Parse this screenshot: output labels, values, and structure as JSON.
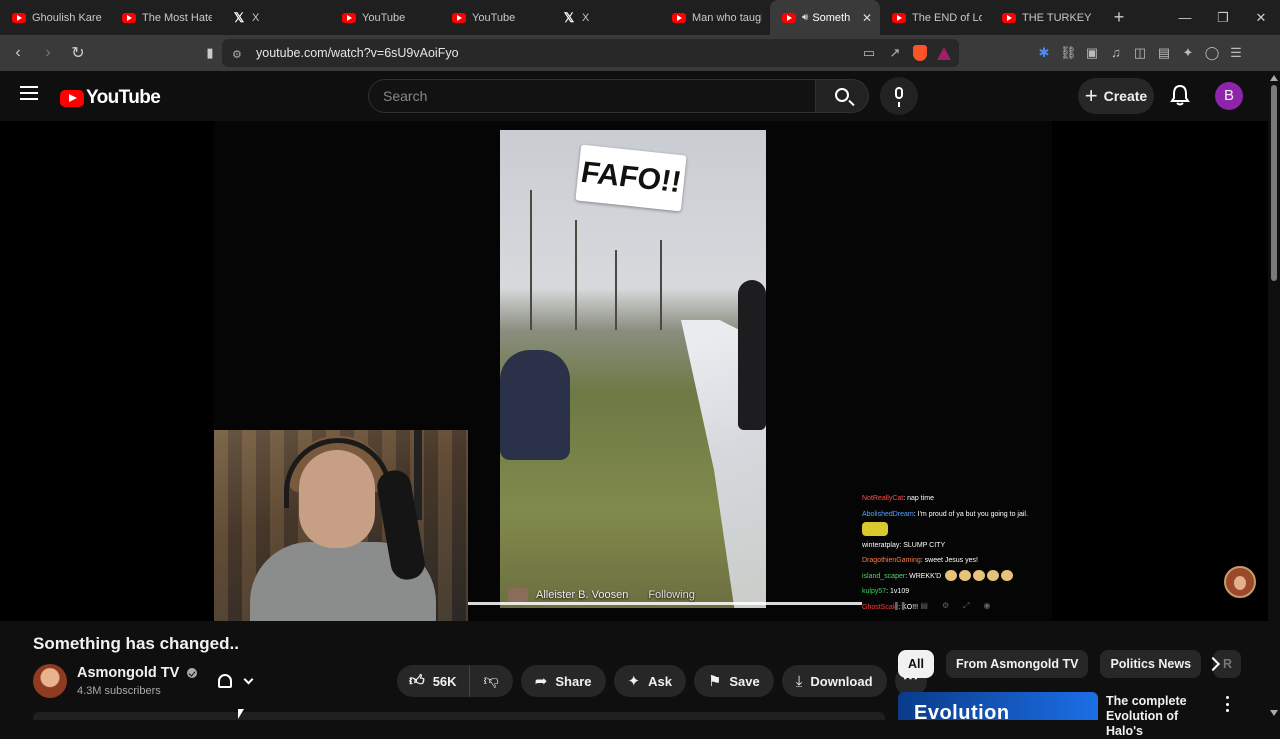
{
  "browser": {
    "tabs": [
      {
        "title": "Ghoulish Karen",
        "icon": "youtube-icon",
        "active": false
      },
      {
        "title": "The Most Hated",
        "icon": "youtube-icon",
        "active": false
      },
      {
        "title": "X",
        "icon": "x-icon",
        "active": false
      },
      {
        "title": "YouTube",
        "icon": "youtube-icon",
        "active": false
      },
      {
        "title": "YouTube",
        "icon": "youtube-icon",
        "active": false
      },
      {
        "title": "X",
        "icon": "x-icon",
        "active": false
      },
      {
        "title": "Man who taugh",
        "icon": "youtube-icon",
        "active": false
      },
      {
        "title": "Someth",
        "icon": "youtube-icon",
        "active": true
      },
      {
        "title": "The END of Lol",
        "icon": "youtube-icon",
        "active": false
      },
      {
        "title": "THE TURKEY TO",
        "icon": "youtube-icon",
        "active": false
      }
    ],
    "url": "youtube.com/watch?v=6sU9vAoiFyo"
  },
  "youtube": {
    "logo_text": "YouTube",
    "search_placeholder": "Search",
    "create_label": "Create",
    "account_initial": "B",
    "accent_color": "#ff0000"
  },
  "video": {
    "sticker_text": "FAFO!!",
    "caption_author": "Alleister B. Voosen",
    "caption_following": "Following",
    "title": "Something has changed..",
    "channel": "Asmongold TV",
    "subscribers": "4.3M subscribers",
    "likes": "56K",
    "actions": {
      "share": "Share",
      "ask": "Ask",
      "save": "Save",
      "download": "Download"
    }
  },
  "chat": [
    {
      "user": "NotReallyCat",
      "msg": "nap time",
      "cls": "u1"
    },
    {
      "user": "AbolishedDream",
      "msg": "I'm proud of ya but you going to jail.",
      "cls": "u2"
    },
    {
      "user": "",
      "msg": "",
      "cls": "u3",
      "emote": true
    },
    {
      "user": "winteratplay",
      "msg": "SLUMP CITY",
      "cls": "u3"
    },
    {
      "user": "DragothienGaming",
      "msg": "sweet Jesus yes!",
      "cls": "u4"
    },
    {
      "user": "island_scaper",
      "msg": "WREKK'D",
      "cls": "u5"
    },
    {
      "user": "kulpy57",
      "msg": "1v109",
      "cls": "u6"
    },
    {
      "user": "GhostScale",
      "msg": "KO!!!",
      "cls": "u7"
    }
  ],
  "sidebar": {
    "chips": [
      "All",
      "From Asmongold TV",
      "Politics News",
      "R"
    ],
    "rec_thumb_text": "Evolution",
    "rec_title": "The complete Evolution of Halo's"
  }
}
